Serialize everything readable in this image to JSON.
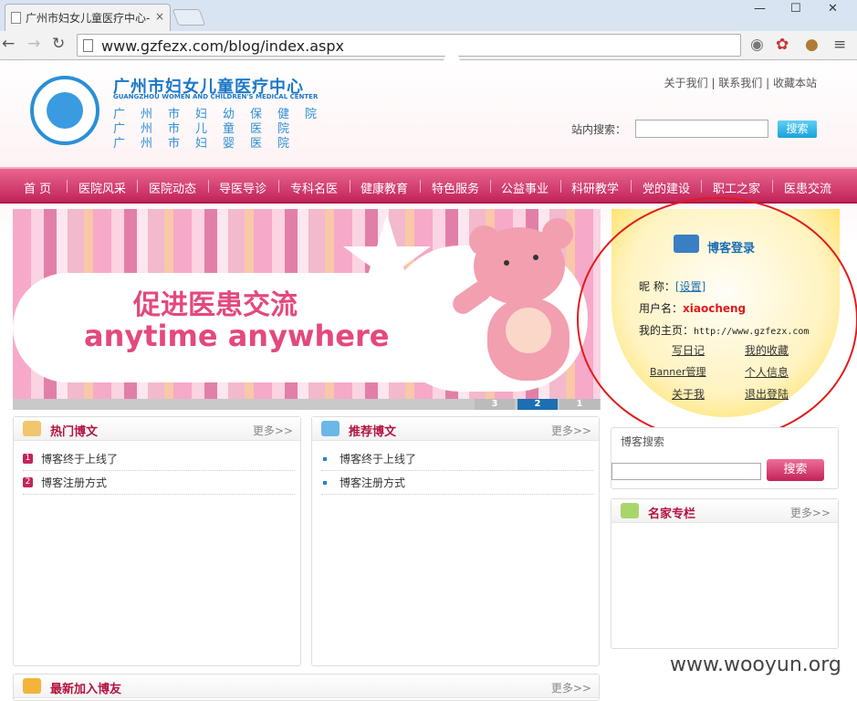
{
  "browser": {
    "tab_title": "广州市妇女儿童医疗中心-",
    "tab_close": "×",
    "url": "www.gzfezx.com/blog/index.aspx",
    "min": "—",
    "max": "☐",
    "close": "✕"
  },
  "header": {
    "title_cn": "广州市妇女儿童医疗中心",
    "title_en": "GUANGZHOU WOMEN AND CHILDREN'S MEDICAL CENTER",
    "sub1": "广州市妇幼保健院",
    "sub2": "广州市儿童医院",
    "sub3": "广州市妇婴医院",
    "links": [
      "关于我们",
      "联系我们",
      "收藏本站"
    ],
    "search_label": "站内搜索：",
    "search_button": "搜索"
  },
  "nav": [
    "首 页",
    "医院风采",
    "医院动态",
    "导医导诊",
    "专科名医",
    "健康教育",
    "特色服务",
    "公益事业",
    "科研教学",
    "党的建设",
    "职工之家",
    "医患交流"
  ],
  "banner": {
    "cn": "促进医患交流",
    "en": "anytime anywhere",
    "pages": [
      "3",
      "2",
      "1"
    ]
  },
  "hot": {
    "title": "热门博文",
    "more": "更多>>",
    "items": [
      "博客终于上线了",
      "博客注册方式"
    ]
  },
  "recommend": {
    "title": "推荐博文",
    "more": "更多>>",
    "items": [
      "博客终于上线了",
      "博客注册方式"
    ]
  },
  "newest": {
    "title": "最新加入博友",
    "more": "更多>>"
  },
  "login": {
    "title": "博客登录",
    "nick_label": "昵  称：",
    "nick_value": "[设置]",
    "user_label": "用户名：",
    "user_value": "xiaocheng",
    "home_label": "我的主页：",
    "home_value": "http://www.gzfezx.com",
    "links": [
      "写日记",
      "我的收藏",
      "Banner管理",
      "个人信息",
      "关于我",
      "退出登陆"
    ]
  },
  "blog_search": {
    "title": "博客搜索",
    "button": "搜索"
  },
  "famous": {
    "title": "名家专栏",
    "more": "更多>>"
  },
  "watermark": "www.wooyun.org",
  "colors": {
    "accent": "#c42359",
    "brand_blue": "#1b78c8",
    "annotation_red": "#e21a1a"
  }
}
